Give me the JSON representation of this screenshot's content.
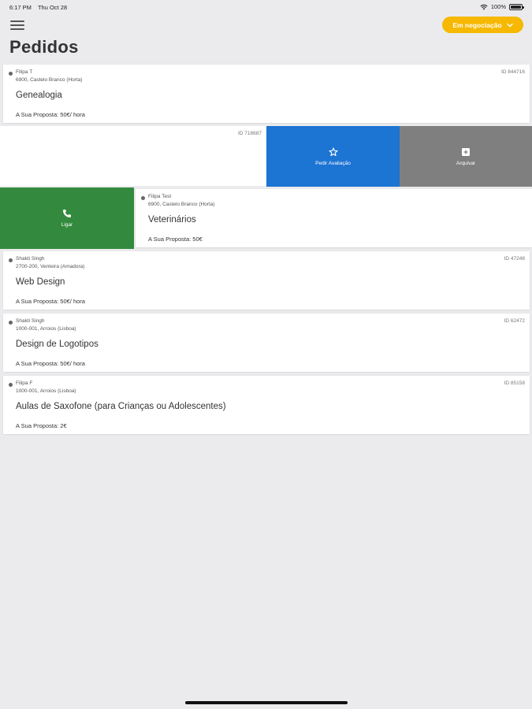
{
  "status_bar": {
    "time": "6:17 PM",
    "date": "Thu Oct 28",
    "battery": "100%"
  },
  "header": {
    "title": "Pedidos",
    "filter_label": "Em negociação"
  },
  "colors": {
    "accent": "#f6b800",
    "blue_action": "#1c74d3",
    "gray_action": "#7f7f7f",
    "green_action": "#338a3e"
  },
  "orders": [
    {
      "client": "Filipa T",
      "location": "6900, Castelo Branco (Horta)",
      "service": "Genealogia",
      "proposal": "A Sua Proposta: 50€/ hora",
      "id": "ID 844716"
    },
    {
      "id": "ID 718687"
    },
    {
      "client": "Filipa Test",
      "location": "6900, Castelo Branco (Horta)",
      "service": "Veterinários",
      "proposal": "A Sua Proposta: 50€"
    },
    {
      "client": "Shakti Singh",
      "location": "2700-200, Venteira (Amadora)",
      "service": "Web Design",
      "proposal": "A Sua Proposta: 50€/ hora",
      "id": "ID 47248"
    },
    {
      "client": "Shakti Singh",
      "location": "1000-001, Arroios (Lisboa)",
      "service": "Design de Logotipos",
      "proposal": "A Sua Proposta: 50€/ hora",
      "id": "ID 62472"
    },
    {
      "client": "Filipa F",
      "location": "1000-001, Arroios (Lisboa)",
      "service": "Aulas de Saxofone (para Crianças ou Adolescentes)",
      "proposal": "A Sua Proposta: 2€",
      "id": "ID 85158"
    }
  ],
  "actions": {
    "evaluate": "Pedir Avaliação",
    "archive": "Arquivar",
    "call": "Ligar"
  },
  "icons": {
    "menu": "hamburger-icon",
    "filter": "chevron-down-icon",
    "evaluate": "star-icon",
    "archive": "archive-box-icon",
    "call": "phone-icon"
  }
}
